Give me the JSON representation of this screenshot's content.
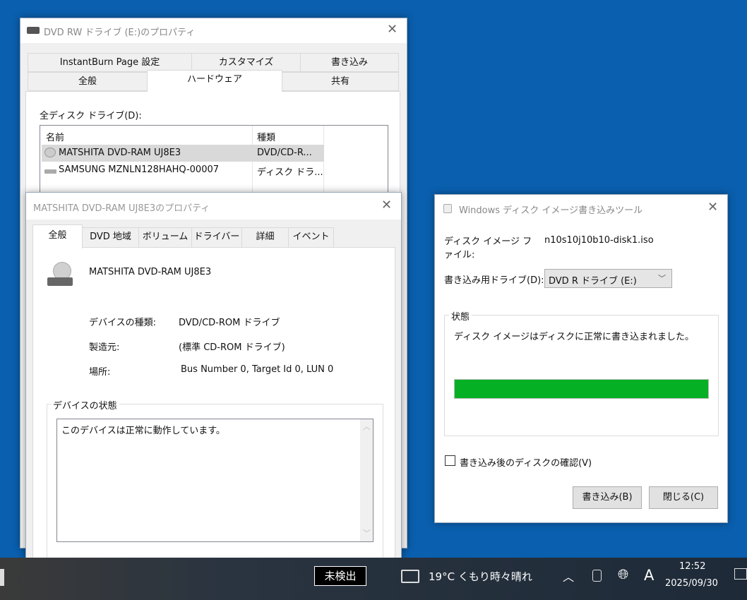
{
  "dvd_props": {
    "title": "DVD RW ドライブ (E:)のプロパティ",
    "tabs_row1": [
      "InstantBurn Page 設定",
      "カスタマイズ",
      "書き込み"
    ],
    "tabs_row2": [
      "全般",
      "ハードウェア",
      "共有"
    ],
    "active_tab": "ハードウェア",
    "list_label": "全ディスク ドライブ(D):",
    "columns": [
      "名前",
      "種類"
    ],
    "rows": [
      {
        "name": "MATSHITA DVD-RAM UJ8E3",
        "type": "DVD/CD-R...",
        "icon": "optical-drive-icon",
        "selected": true
      },
      {
        "name": "SAMSUNG MZNLN128HAHQ-00007",
        "type": "ディスク ドラ...",
        "icon": "disk-drive-icon",
        "selected": false
      }
    ]
  },
  "device_props": {
    "title": "MATSHITA DVD-RAM UJ8E3のプロパティ",
    "tabs": [
      "全般",
      "DVD 地域",
      "ボリューム",
      "ドライバー",
      "詳細",
      "イベント"
    ],
    "active_tab": "全般",
    "device_name": "MATSHITA DVD-RAM UJ8E3",
    "props": [
      {
        "label": "デバイスの種類:",
        "value": "DVD/CD-ROM ドライブ"
      },
      {
        "label": "製造元:",
        "value": "(標準 CD-ROM ドライブ)"
      },
      {
        "label": "場所:",
        "value": "Bus Number 0, Target Id 0, LUN 0"
      }
    ],
    "status_group": "デバイスの状態",
    "status_text": "このデバイスは正常に動作しています。"
  },
  "burner": {
    "title": "Windows ディスク イメージ書き込みツール",
    "file_label": "ディスク イメージ ファイル:",
    "file_value": "n10s10j10b10-disk1.iso",
    "drive_label": "書き込み用ドライブ(D):",
    "drive_value": "DVD R ドライブ (E:)",
    "status_group": "状態",
    "status_text": "ディスク イメージはディスクに正常に書き込まれました。",
    "progress_percent": 100,
    "progress_color": "#06b025",
    "verify_label": "書き込み後のディスクの確認(V)",
    "verify_checked": false,
    "burn_button": "書き込み(B)",
    "close_button": "閉じる(C)"
  },
  "taskbar": {
    "ime_status": "未検出",
    "weather": "19°C くもり時々晴れ",
    "ime_mode": "A",
    "time": "12:52",
    "date": "2025/09/30"
  }
}
